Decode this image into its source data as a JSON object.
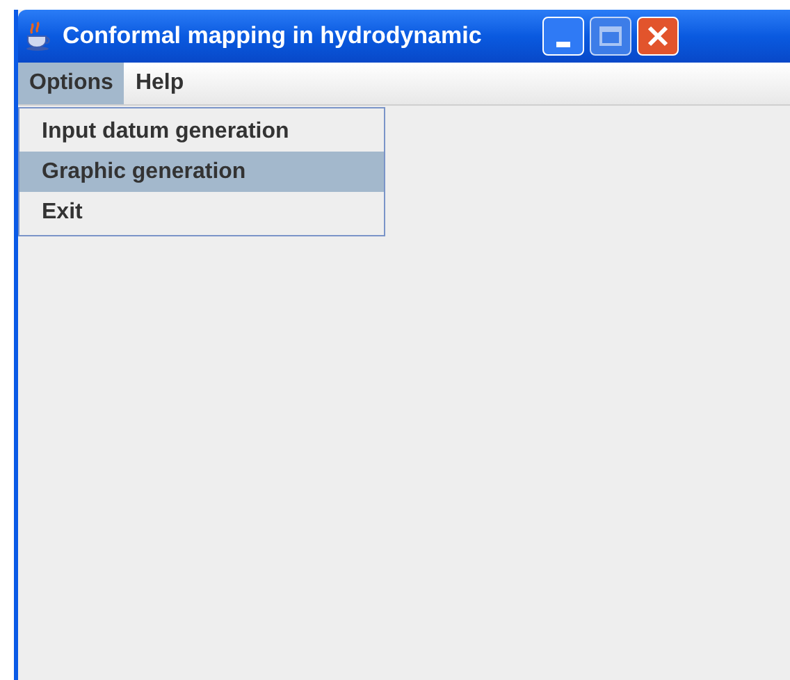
{
  "window": {
    "title": "Conformal mapping in hydrodynamic"
  },
  "menu_bar": [
    {
      "label": "Options",
      "selected": true
    },
    {
      "label": "Help",
      "selected": false
    }
  ],
  "dropdown": [
    {
      "label": "Input datum generation",
      "selected": false
    },
    {
      "label": "Graphic generation",
      "selected": true
    },
    {
      "label": "Exit",
      "selected": false
    }
  ]
}
